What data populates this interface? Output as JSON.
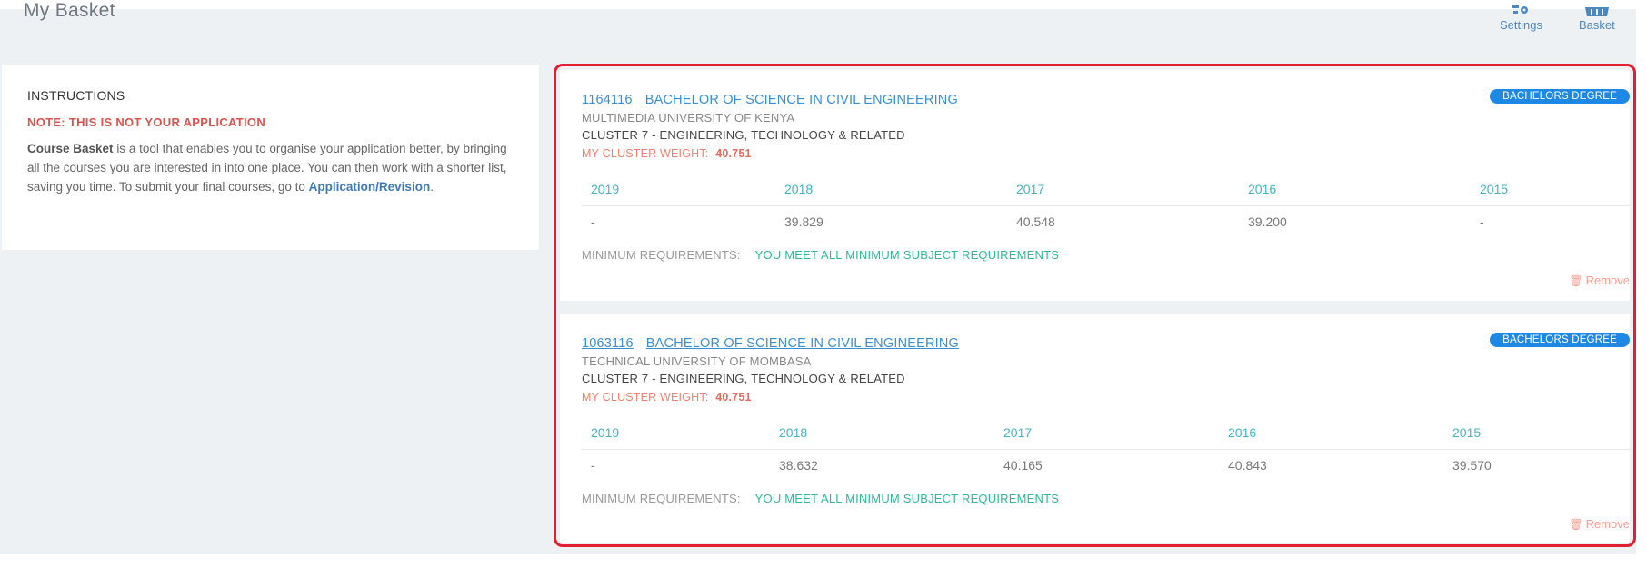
{
  "page": {
    "title": "My Basket"
  },
  "header": {
    "settings_label": "Settings",
    "settings_icon": "settings-gears-icon",
    "basket_label": "Basket",
    "basket_icon": "basket-icon",
    "accent": "#4a88c0"
  },
  "instructions": {
    "title": "INSTRUCTIONS",
    "note": "NOTE: THIS IS NOT YOUR APPLICATION",
    "body_bold": "Course Basket",
    "body_text": "is a tool that enables you to organise your application better, by bringing all the courses you are interested in into one place. You can then work with a shorter list, saving you time. To submit your final courses, go to",
    "link": "Application/Revision",
    "end": "."
  },
  "courses": [
    {
      "code": "1164116",
      "name": "BACHELOR OF SCIENCE IN CIVIL ENGINEERING",
      "university": "MULTIMEDIA UNIVERSITY OF KENYA",
      "cluster": "CLUSTER 7 - ENGINEERING, TECHNOLOGY & RELATED",
      "cluster_weight_label": "MY CLUSTER WEIGHT:",
      "cluster_weight": "40.751",
      "badge": "BACHELORS DEGREE",
      "years": [
        "2019",
        "2018",
        "2017",
        "2016",
        "2015"
      ],
      "cutoffs": [
        "-",
        "39.829",
        "40.548",
        "39.200",
        "-"
      ],
      "min_req_label": "MINIMUM REQUIREMENTS:",
      "min_req_value": "YOU MEET ALL MINIMUM SUBJECT REQUIREMENTS",
      "remove_label": "Remove"
    },
    {
      "code": "1063116",
      "name": "BACHELOR OF SCIENCE IN CIVIL ENGINEERING",
      "university": "TECHNICAL UNIVERSITY OF MOMBASA",
      "cluster": "CLUSTER 7 - ENGINEERING, TECHNOLOGY & RELATED",
      "cluster_weight_label": "MY CLUSTER WEIGHT:",
      "cluster_weight": "40.751",
      "badge": "BACHELORS DEGREE",
      "years": [
        "2019",
        "2018",
        "2017",
        "2016",
        "2015"
      ],
      "cutoffs": [
        "-",
        "38.632",
        "40.165",
        "40.843",
        "39.570"
      ],
      "min_req_label": "MINIMUM REQUIREMENTS:",
      "min_req_value": "YOU MEET ALL MINIMUM SUBJECT REQUIREMENTS",
      "remove_label": "Remove"
    }
  ],
  "colors": {
    "badge": "#1e88e5",
    "link": "#3a8fd0",
    "year_header": "#44b3c2",
    "meets_requirements": "#2fb996",
    "note": "#d9534f",
    "remove": "#f5a090",
    "highlight_border": "#e02030"
  }
}
